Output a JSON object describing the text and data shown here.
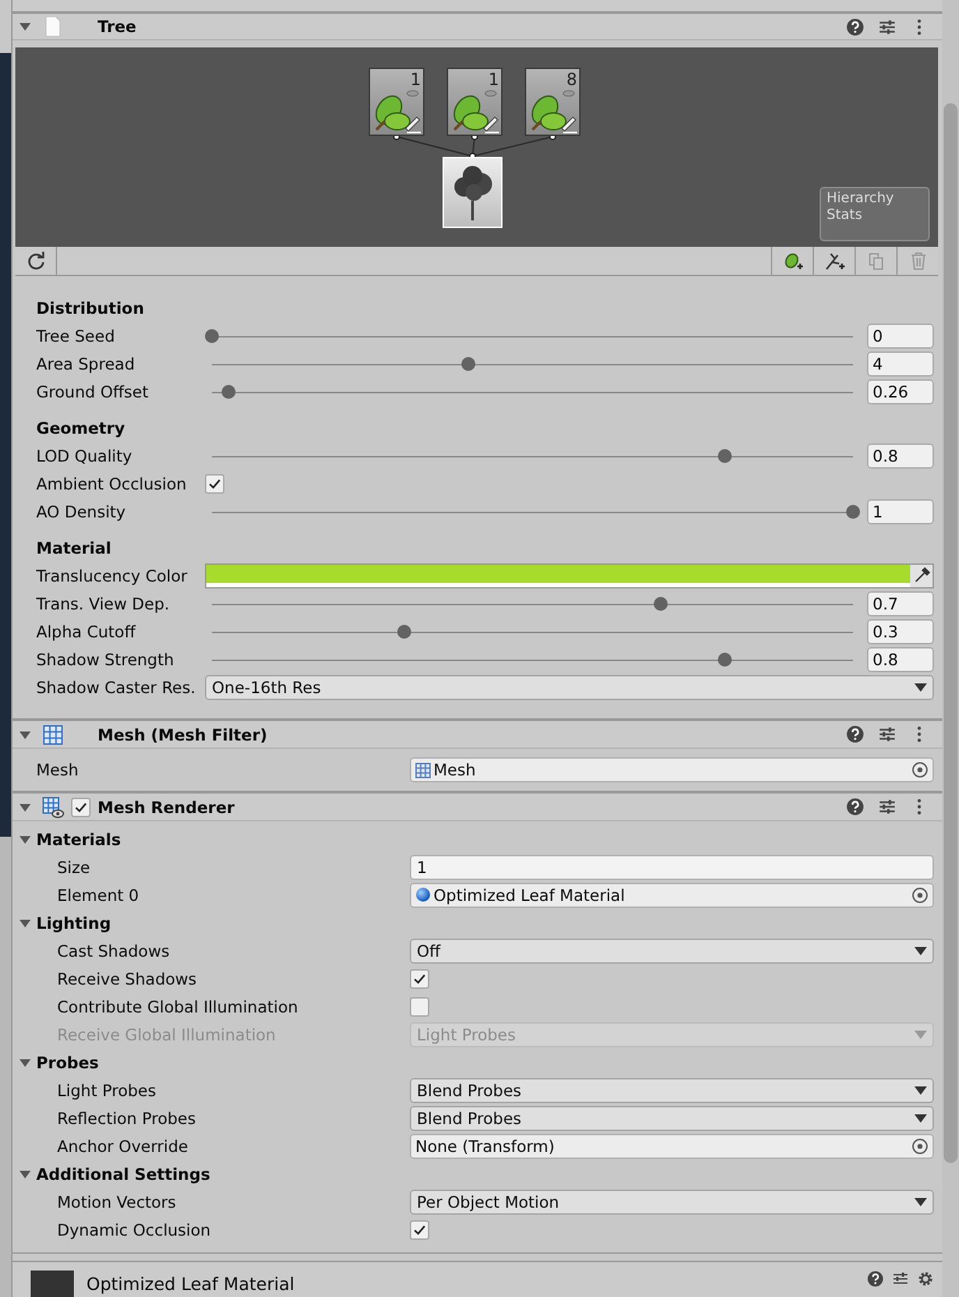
{
  "components": [
    {
      "kind": "tree",
      "title": "Tree",
      "expanded": true,
      "graph": {
        "leaf_nodes": [
          {
            "count": "1"
          },
          {
            "count": "1"
          },
          {
            "count": "8"
          }
        ],
        "stats": "Hierarchy Stats"
      },
      "sections": [
        {
          "title": "Distribution",
          "rows": [
            {
              "kind": "slider",
              "label": "Tree Seed",
              "level": 0,
              "value": "0"
            },
            {
              "kind": "slider",
              "label": "Area Spread",
              "level": 0.4,
              "value": "4"
            },
            {
              "kind": "slider",
              "label": "Ground Offset",
              "level": 0.026,
              "value": "0.26"
            }
          ]
        },
        {
          "title": "Geometry",
          "rows": [
            {
              "kind": "slider",
              "label": "LOD Quality",
              "level": 0.8,
              "value": "0.8"
            },
            {
              "kind": "checkbox",
              "label": "Ambient Occlusion",
              "checked": true
            },
            {
              "kind": "slider",
              "label": "AO Density",
              "level": 1,
              "value": "1"
            }
          ]
        },
        {
          "title": "Material",
          "rows": [
            {
              "kind": "color",
              "label": "Translucency Color",
              "color": "#a8dc2c"
            },
            {
              "kind": "slider",
              "label": "Trans. View Dep.",
              "level": 0.7,
              "value": "0.7"
            },
            {
              "kind": "slider",
              "label": "Alpha Cutoff",
              "level": 0.3,
              "value": "0.3"
            },
            {
              "kind": "slider",
              "label": "Shadow Strength",
              "level": 0.8,
              "value": "0.8"
            },
            {
              "kind": "dropdown",
              "label": "Shadow Caster Res.",
              "value": "One-16th Res"
            }
          ]
        }
      ]
    },
    {
      "kind": "mesh_filter",
      "title": "Mesh (Mesh Filter)",
      "expanded": true,
      "rows": [
        {
          "kind": "mesh_object",
          "label": "Mesh",
          "value": "Mesh"
        }
      ]
    },
    {
      "kind": "mesh_renderer",
      "title": "Mesh Renderer",
      "expanded": true,
      "enabled": true,
      "groups": [
        {
          "title": "Materials",
          "expanded": true,
          "rows": [
            {
              "kind": "text",
              "label": "Size",
              "value": "1",
              "disabled": false
            },
            {
              "kind": "material_object",
              "label": "Element 0",
              "value": "Optimized Leaf Material",
              "disabled": false
            }
          ]
        },
        {
          "title": "Lighting",
          "expanded": true,
          "rows": [
            {
              "kind": "dropdown",
              "label": "Cast Shadows",
              "value": "Off",
              "disabled": false
            },
            {
              "kind": "checkbox",
              "label": "Receive Shadows",
              "checked": true,
              "disabled": false
            },
            {
              "kind": "checkbox",
              "label": "Contribute Global Illumination",
              "checked": false,
              "disabled": false
            },
            {
              "kind": "dropdown",
              "label": "Receive Global Illumination",
              "value": "Light Probes",
              "disabled": true
            }
          ]
        },
        {
          "title": "Probes",
          "expanded": true,
          "rows": [
            {
              "kind": "dropdown",
              "label": "Light Probes",
              "value": "Blend Probes",
              "disabled": false
            },
            {
              "kind": "dropdown",
              "label": "Reflection Probes",
              "value": "Blend Probes",
              "disabled": false
            },
            {
              "kind": "object",
              "label": "Anchor Override",
              "value": "None (Transform)",
              "disabled": false
            }
          ]
        },
        {
          "title": "Additional Settings",
          "expanded": true,
          "rows": [
            {
              "kind": "dropdown",
              "label": "Motion Vectors",
              "value": "Per Object Motion",
              "disabled": false
            },
            {
              "kind": "checkbox",
              "label": "Dynamic Occlusion",
              "checked": true,
              "disabled": false
            }
          ]
        }
      ]
    }
  ],
  "material_footer": {
    "title": "Optimized Leaf Material"
  }
}
